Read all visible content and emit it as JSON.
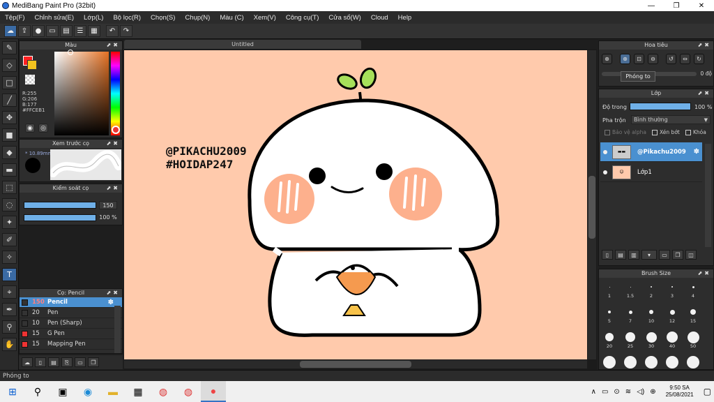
{
  "window": {
    "title": "MediBang Paint Pro (32bit)",
    "minimize": "—",
    "maximize": "❐",
    "close": "✕"
  },
  "menu": [
    "Tệp(F)",
    "Chỉnh sửa(E)",
    "Lớp(L)",
    "Bộ lọc(R)",
    "Chọn(S)",
    "Chụp(N)",
    "Màu (C)",
    "Xem(V)",
    "Công cụ(T)",
    "Cửa sổ(W)",
    "Cloud",
    "Help"
  ],
  "toolbar_icons": [
    "cloud-icon",
    "export-icon",
    "comment-icon",
    "chat-icon",
    "page-icon",
    "list-icon",
    "grid-icon",
    "undo-icon",
    "redo-icon"
  ],
  "panels": {
    "color": {
      "title": "Màu",
      "r": "R:255",
      "g": "G:206",
      "b": "B:177",
      "hex": "#FFCEB1",
      "primary": "#ff2020",
      "secondary": "#f2c31f"
    },
    "preview": {
      "title": "Xem trước cọ",
      "size": "* 10.89mm"
    },
    "brush_control": {
      "title": "Kiểm soát cọ",
      "size_value": "150",
      "opacity_value": "100 %"
    },
    "brush_list": {
      "title": "Cọ: Pencil",
      "items": [
        {
          "size": "150",
          "name": "Pencil",
          "selected": true
        },
        {
          "size": "20",
          "name": "Pen"
        },
        {
          "size": "10",
          "name": "Pen (Sharp)"
        },
        {
          "size": "15",
          "name": "G Pen"
        },
        {
          "size": "15",
          "name": "Mapping Pen"
        }
      ]
    },
    "navigator": {
      "title": "Hoa tiêu",
      "zoom_value": "0 độ",
      "tooltip": "Phóng to"
    },
    "layer": {
      "title": "Lớp",
      "opacity_label": "Độ trong",
      "opacity_value": "100 %",
      "blend_label": "Pha trộn",
      "blend_value": "Bình thường",
      "protect_alpha": "Bảo vệ alpha",
      "clipping": "Xén bớt",
      "lock": "Khóa",
      "layers": [
        {
          "name": "@Pikachu2009",
          "selected": true
        },
        {
          "name": "Lớp1"
        }
      ]
    },
    "brush_size": {
      "title": "Brush Size",
      "sizes": [
        "1",
        "1.5",
        "2",
        "3",
        "4",
        "5",
        "7",
        "10",
        "12",
        "15",
        "20",
        "25",
        "30",
        "40",
        "50"
      ]
    }
  },
  "document": {
    "tab": "Untitled",
    "watermark_line1": "@PIKACHU2009",
    "watermark_line2": "#HOIDAP247",
    "background": "#ffcaac"
  },
  "status": {
    "text": "Phóng to"
  },
  "taskbar": {
    "time": "9:50 SA",
    "date": "25/08/2021"
  }
}
